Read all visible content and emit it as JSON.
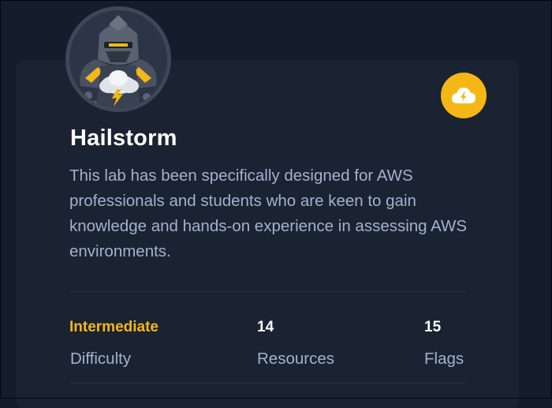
{
  "lab": {
    "title": "Hailstorm",
    "description": "This lab has been specifically designed for AWS professionals and students who are keen to gain knowledge and hands-on experience in assessing AWS environments.",
    "avatar_icon": "armored-knight-storm-cloud-icon",
    "badge_icon": "cloud-lightning-icon"
  },
  "stats": [
    {
      "value": "Intermediate",
      "label": "Difficulty"
    },
    {
      "value": "14",
      "label": "Resources"
    },
    {
      "value": "15",
      "label": "Flags"
    }
  ],
  "colors": {
    "page_background": "#141d2b",
    "card_background": "#1a2332",
    "accent": "#f5b716",
    "text_primary": "#ffffff",
    "text_secondary": "#a4b1cd"
  }
}
